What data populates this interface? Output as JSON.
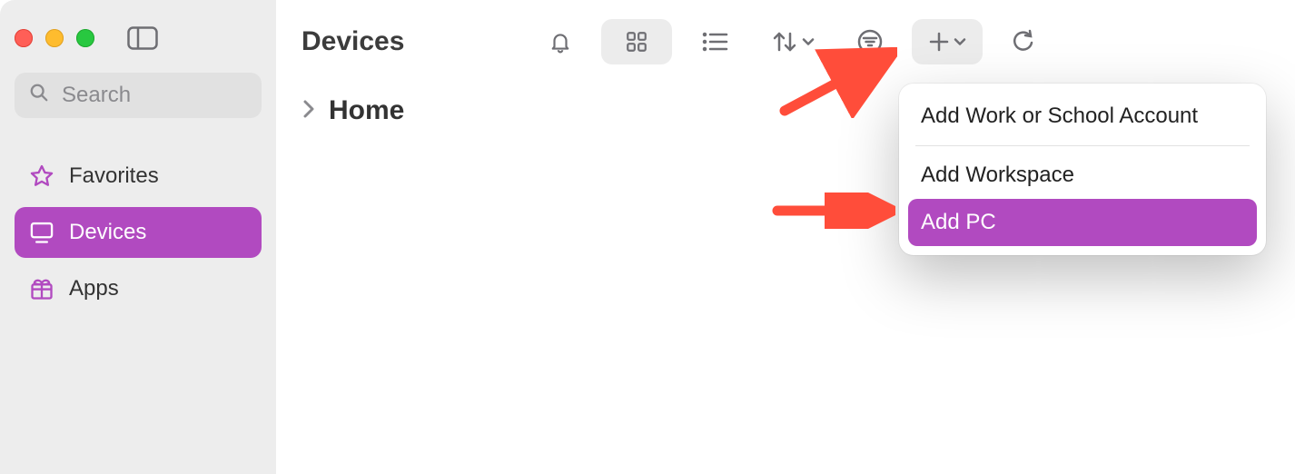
{
  "colors": {
    "accent": "#b14ac0",
    "arrow": "#ff4d3a"
  },
  "sidebar": {
    "search_placeholder": "Search",
    "items": [
      {
        "id": "favorites",
        "label": "Favorites",
        "active": false
      },
      {
        "id": "devices",
        "label": "Devices",
        "active": true
      },
      {
        "id": "apps",
        "label": "Apps",
        "active": false
      }
    ]
  },
  "header": {
    "title": "Devices"
  },
  "breadcrumb": {
    "label": "Home"
  },
  "add_menu": {
    "items": [
      {
        "id": "add-account",
        "label": "Add Work or School Account",
        "highlighted": false
      },
      {
        "id": "add-workspace",
        "label": "Add Workspace",
        "highlighted": false
      },
      {
        "id": "add-pc",
        "label": "Add PC",
        "highlighted": true
      }
    ]
  }
}
